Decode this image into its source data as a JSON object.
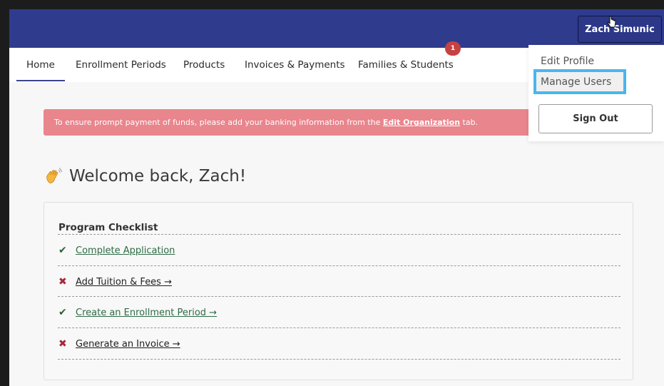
{
  "header": {
    "user_name": "Zach Simunic"
  },
  "nav": {
    "items": [
      {
        "label": "Home"
      },
      {
        "label": "Enrollment Periods"
      },
      {
        "label": "Products"
      },
      {
        "label": "Invoices & Payments"
      },
      {
        "label": "Families & Students"
      }
    ],
    "active": "Home",
    "badge_count": "1"
  },
  "alert": {
    "text_before": "To ensure prompt payment of funds, please add your banking information from the ",
    "link_text": "Edit Organization",
    "text_after": " tab."
  },
  "welcome": {
    "icon": "waving-hand-icon",
    "text": "Welcome back, Zach!"
  },
  "checklist": {
    "title": "Program Checklist",
    "items": [
      {
        "label": "Complete Application",
        "status": "done",
        "mark": "✔"
      },
      {
        "label": "Add Tuition & Fees →",
        "status": "todo",
        "mark": "✖"
      },
      {
        "label": "Create an Enrollment Period →",
        "status": "done",
        "mark": "✔"
      },
      {
        "label": "Generate an Invoice →",
        "status": "todo",
        "mark": "✖"
      }
    ]
  },
  "user_menu": {
    "items": [
      {
        "label": "Edit Profile"
      },
      {
        "label": "Manage Users"
      }
    ],
    "highlighted": "Manage Users",
    "sign_out_label": "Sign Out"
  },
  "colors": {
    "header_bg": "#2f3b8c",
    "alert_bg": "#e9858c",
    "badge_bg": "#c64242",
    "highlight_border": "#4ab5ee",
    "done_color": "#2d6b44",
    "todo_color": "#a5283a"
  }
}
